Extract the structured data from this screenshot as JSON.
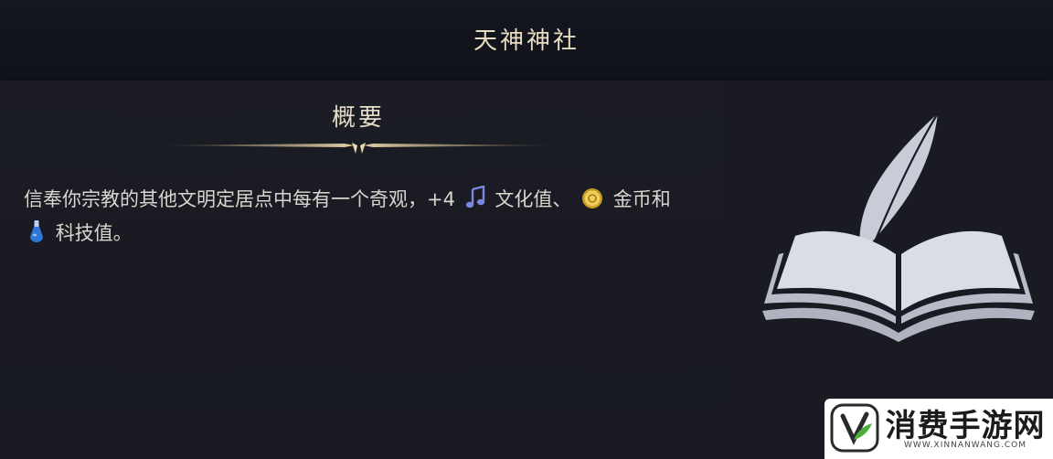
{
  "header": {
    "title": "天神神社"
  },
  "overview": {
    "title": "概要",
    "description": {
      "part1": "信奉你宗教的其他文明定居点中每有一个奇观，",
      "amount": "+4",
      "culture_label": "文化值、",
      "gold_label": "金币和",
      "science_label": "科技值。"
    }
  },
  "icons": {
    "culture": "music-note-icon",
    "gold": "gold-coin-icon",
    "science": "flask-icon",
    "illustration": "book-quill-icon"
  },
  "watermark": {
    "text": "消费手游网",
    "url": "WWW.XINNANWANG.COM"
  },
  "colors": {
    "background": "#1a1b21",
    "header_text": "#e8dcc0",
    "culture": "#6f7bd6",
    "gold": "#d9b23a",
    "science": "#4d8fe0"
  }
}
